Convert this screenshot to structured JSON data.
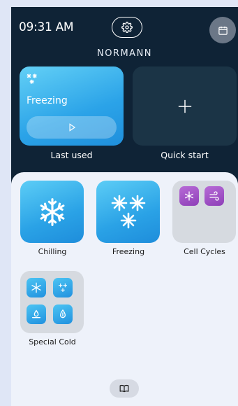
{
  "status": {
    "time": "09:31 AM"
  },
  "header": {
    "brand": "NORMANN"
  },
  "last_used": {
    "program": "Freezing",
    "caption": "Last used"
  },
  "quick_start": {
    "caption": "Quick start"
  },
  "programs": [
    {
      "label": "Chilling",
      "icon": "snowflake-icon"
    },
    {
      "label": "Freezing",
      "icon": "triple-snowflake-icon"
    },
    {
      "label": "Cell Cycles",
      "icon": "cell-cycles-icon"
    },
    {
      "label": "Special Cold",
      "icon": "special-cold-icon"
    }
  ],
  "colors": {
    "header_bg": "#0f2336",
    "accent_blue": "#2ba3e8",
    "purple": "#a656c8",
    "panel_bg": "#eef2fa"
  },
  "icons": [
    "gear-icon",
    "calendar-icon",
    "play-icon",
    "plus-icon",
    "book-icon"
  ]
}
